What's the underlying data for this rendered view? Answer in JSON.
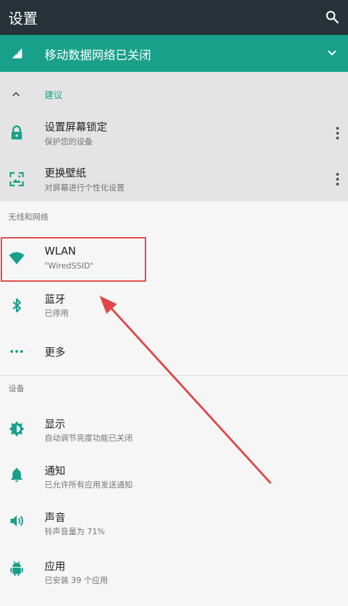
{
  "appbar": {
    "title": "设置"
  },
  "banner": {
    "text": "移动数据网络已关闭"
  },
  "suggestions": {
    "header": "建议",
    "items": [
      {
        "title": "设置屏幕锁定",
        "subtitle": "保护您的设备"
      },
      {
        "title": "更换壁纸",
        "subtitle": "对屏幕进行个性化设置"
      }
    ]
  },
  "wireless": {
    "header": "无线和网络",
    "items": [
      {
        "title": "WLAN",
        "subtitle": "\"WiredSSID\""
      },
      {
        "title": "蓝牙",
        "subtitle": "已停用"
      },
      {
        "title": "更多"
      }
    ]
  },
  "device": {
    "header": "设备",
    "items": [
      {
        "title": "显示",
        "subtitle": "自动调节亮度功能已关闭"
      },
      {
        "title": "通知",
        "subtitle": "已允许所有应用发送通知"
      },
      {
        "title": "声音",
        "subtitle": "铃声音量为 71%"
      },
      {
        "title": "应用",
        "subtitle": "已安装 39 个应用"
      }
    ]
  },
  "colors": {
    "toolbar": "#263238",
    "accent": "#18a08a",
    "annotation": "#e04848"
  },
  "icons": {
    "search": "search-icon",
    "signal": "signal-off-icon",
    "expand": "chevron-down-icon",
    "collapse": "chevron-up-icon",
    "lock": "lock-icon",
    "wallpaper": "wallpaper-icon",
    "overflow": "more-vert-icon",
    "wifi": "wifi-icon",
    "bluetooth": "bluetooth-icon",
    "more": "more-horiz-icon",
    "display": "brightness-icon",
    "notifications": "bell-icon",
    "sound": "volume-icon",
    "apps": "android-icon"
  }
}
